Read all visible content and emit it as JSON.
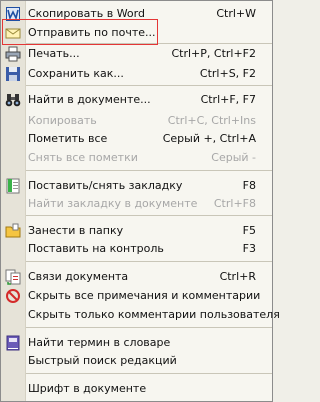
{
  "menu": {
    "items": [
      {
        "label": "Скопировать в Word",
        "shortcut": "Ctrl+W",
        "icon": "word-icon"
      },
      {
        "label": "Отправить по почте...",
        "shortcut": "",
        "icon": "envelope-icon"
      },
      {
        "label": "Печать...",
        "shortcut": "Ctrl+P, Ctrl+F2",
        "icon": "printer-icon"
      },
      {
        "label": "Сохранить как...",
        "shortcut": "Ctrl+S, F2",
        "icon": "floppy-disk-icon"
      },
      {
        "label": "Найти в документе...",
        "shortcut": "Ctrl+F, F7",
        "icon": "binoculars-icon"
      },
      {
        "label": "Копировать",
        "shortcut": "Ctrl+C, Ctrl+Ins",
        "disabled": true
      },
      {
        "label": "Пометить все",
        "shortcut": "Серый +, Ctrl+A"
      },
      {
        "label": "Снять все пометки",
        "shortcut": "Серый -",
        "disabled": true
      },
      {
        "label": "Поставить/снять закладку",
        "shortcut": "F8",
        "icon": "bookmark-icon"
      },
      {
        "label": "Найти закладку в документе",
        "shortcut": "Ctrl+F8",
        "disabled": true
      },
      {
        "label": "Занести в папку",
        "shortcut": "F5",
        "icon": "folder-icon"
      },
      {
        "label": "Поставить на контроль",
        "shortcut": "F3"
      },
      {
        "label": "Связи документа",
        "shortcut": "Ctrl+R",
        "icon": "document-links-icon"
      },
      {
        "label": "Скрыть все примечания и комментарии",
        "shortcut": "",
        "icon": "no-entry-icon"
      },
      {
        "label": "Скрыть только комментарии пользователя",
        "shortcut": ""
      },
      {
        "label": "Найти термин в словаре",
        "shortcut": "",
        "icon": "dictionary-icon"
      },
      {
        "label": "Быстрый поиск редакций",
        "shortcut": ""
      },
      {
        "label": "Шрифт в документе",
        "shortcut": ""
      }
    ]
  },
  "colors": {
    "highlight_border": "#e43636",
    "disabled_text": "#a7a7a7"
  }
}
